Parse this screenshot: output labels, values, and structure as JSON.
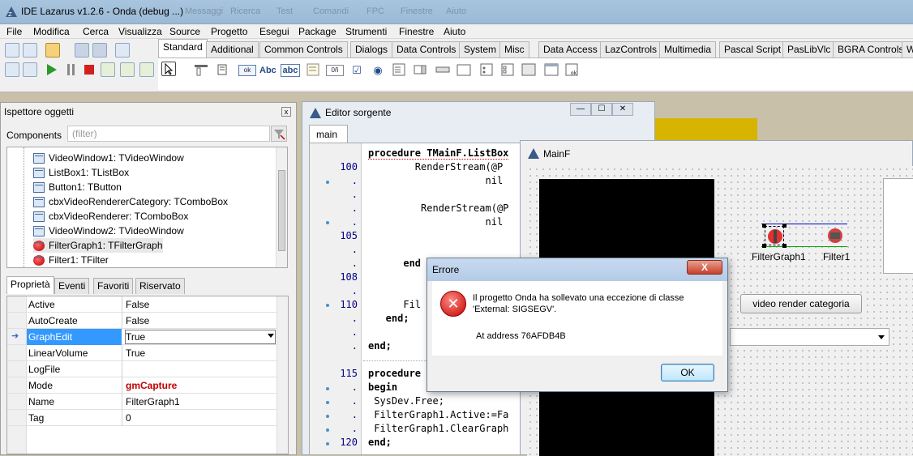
{
  "titlebar": {
    "title": "IDE Lazarus v1.2.6 - Onda (debug ...)",
    "blurred_items": [
      "Messaggi",
      "Ricerca",
      "Test",
      "Comandi",
      "FPC",
      "Finestre",
      "Aiuto"
    ]
  },
  "menu": [
    "File",
    "Modifica",
    "Cerca",
    "Visualizza",
    "Source",
    "Progetto",
    "Esegui",
    "Package",
    "Strumenti",
    "Finestre",
    "Aiuto"
  ],
  "palette": {
    "tabs": [
      "Standard",
      "Additional",
      "Common Controls",
      "Dialogs",
      "Data Controls",
      "System",
      "Misc",
      "Data Access",
      "LazControls",
      "Multimedia",
      "Pascal Script",
      "PasLibVlc",
      "BGRA Controls",
      "W"
    ],
    "active_tab": "Standard",
    "component_glyphs": [
      "ok",
      "Abc",
      "abc",
      "0ñ"
    ]
  },
  "inspector": {
    "title": "Ispettore oggetti",
    "close": "x",
    "components_label": "Components",
    "filter_placeholder": "(filter)",
    "tree": [
      "VideoWindow1: TVideoWindow",
      "ListBox1: TListBox",
      "Button1: TButton",
      "cbxVideoRendererCategory: TComboBox",
      "cbxVideoRenderer: TComboBox",
      "VideoWindow2: TVideoWindow",
      "FilterGraph1: TFilterGraph",
      "Filter1: TFilter"
    ],
    "tabs": [
      "Proprietà",
      "Eventi",
      "Favoriti",
      "Riservato"
    ],
    "properties": [
      {
        "name": "Active",
        "value": "False"
      },
      {
        "name": "AutoCreate",
        "value": "False"
      },
      {
        "name": "GraphEdit",
        "value": "True"
      },
      {
        "name": "LinearVolume",
        "value": "True"
      },
      {
        "name": "LogFile",
        "value": ""
      },
      {
        "name": "Mode",
        "value": "gmCapture"
      },
      {
        "name": "Name",
        "value": "FilterGraph1"
      },
      {
        "name": "Tag",
        "value": "0"
      }
    ]
  },
  "editor": {
    "title": "Editor sorgente",
    "tab": "main",
    "line_numbers": [
      "100",
      ".",
      ".",
      ".",
      "105",
      ".",
      ".",
      "108",
      ".",
      "110",
      ".",
      ".",
      ".",
      "115",
      ".",
      ".",
      ".",
      ".",
      "120"
    ],
    "lines": [
      "procedure TMainF.ListBox",
      "        RenderStream(@P",
      "                    nil",
      "",
      "         RenderStream(@P",
      "                    nil",
      "",
      "      end",
      "",
      "",
      "      Fil",
      "   end;",
      "",
      "end;",
      "",
      "procedure",
      "begin",
      " SysDev.Free;",
      " FilterGraph1.Active:=Fa",
      " FilterGraph1.ClearGraph",
      "end;"
    ]
  },
  "mainf": {
    "title": "MainF",
    "filtergraph_label": "FilterGraph1",
    "filter_label": "Filter1",
    "button_label": "video render categoria"
  },
  "dialog": {
    "title": "Errore",
    "close": "X",
    "message": "Il progetto Onda ha sollevato una eccezione di classe 'External: SIGSEGV'.",
    "address": "At address 76AFDB4B",
    "ok": "OK"
  },
  "colors": {
    "selection": "#3399ff",
    "mode_value": "#c00000",
    "keyword": "#000000",
    "line_numbers": "#000080"
  }
}
